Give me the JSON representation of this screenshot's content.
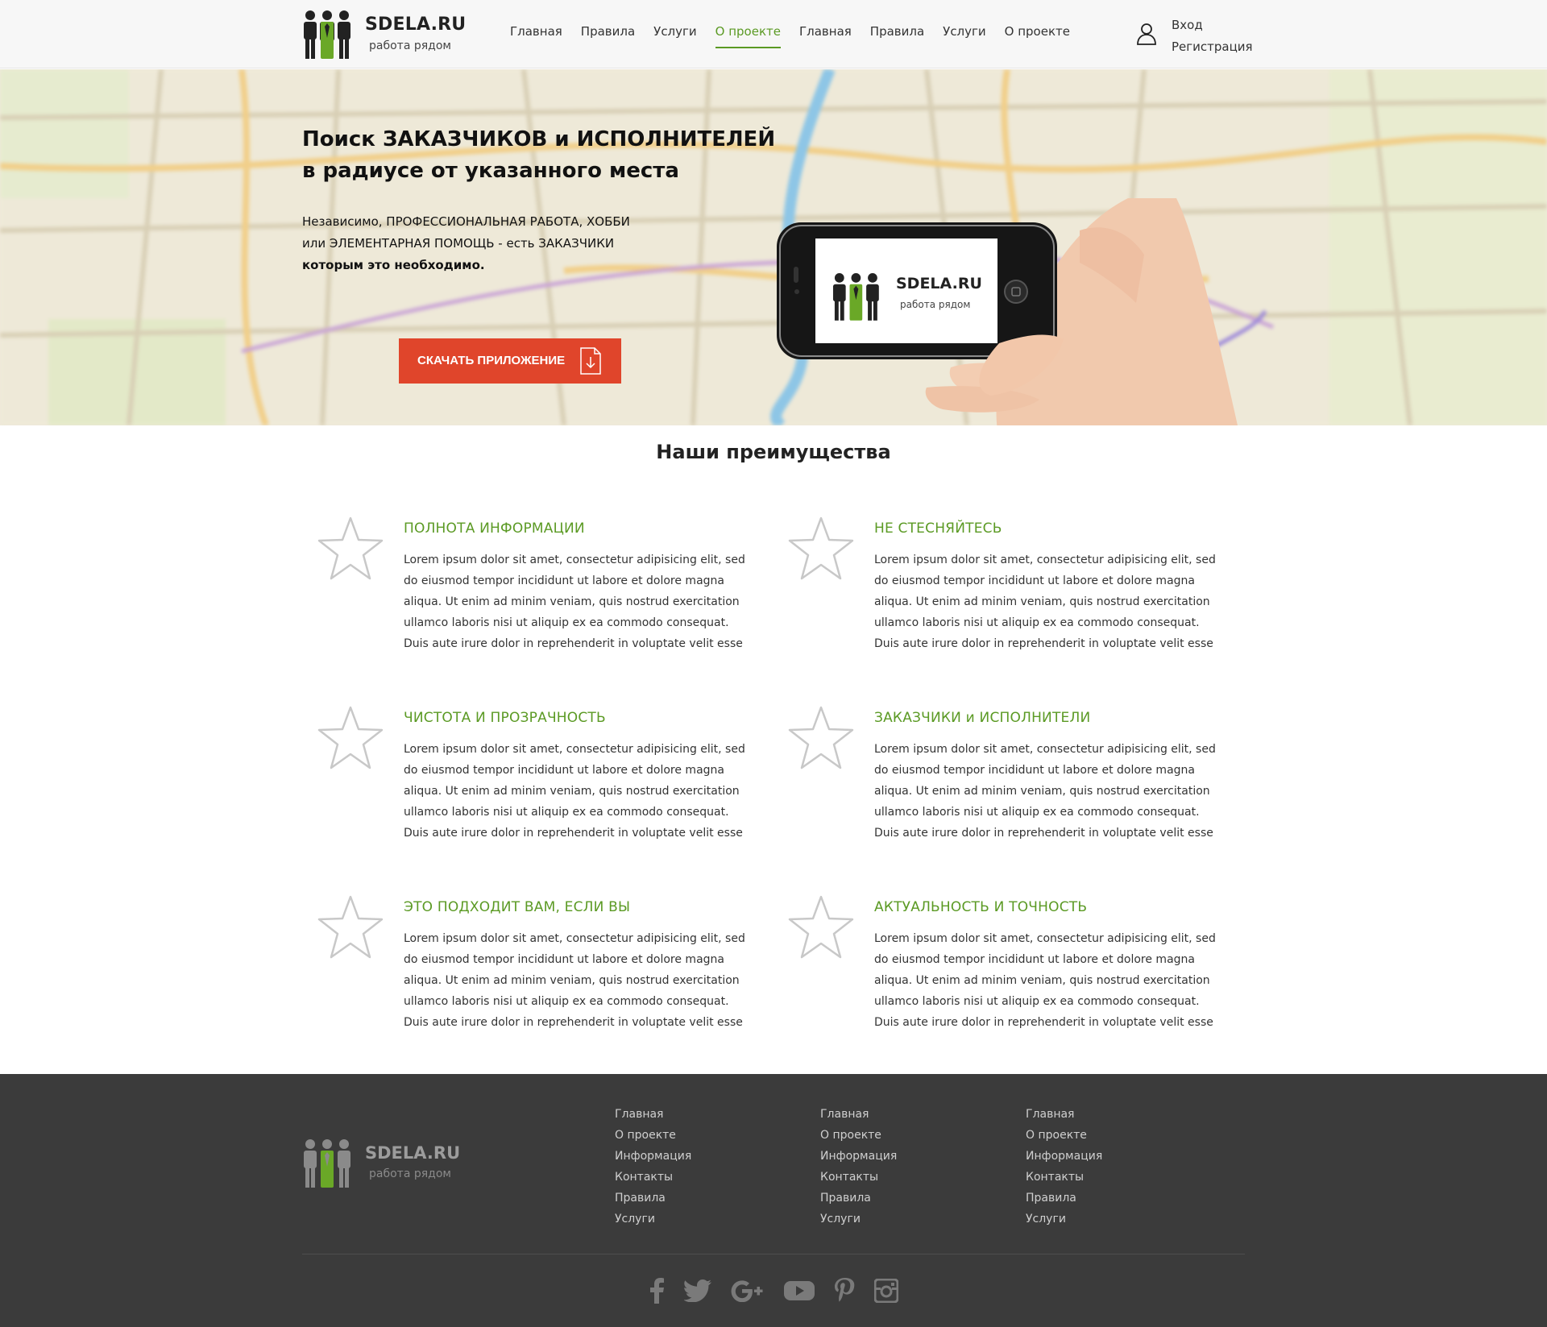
{
  "header": {
    "logo_name": "SDELA.RU",
    "logo_tagline": "работа рядом",
    "nav": [
      {
        "label": "Главная"
      },
      {
        "label": "Правила"
      },
      {
        "label": "Услуги"
      },
      {
        "label": "О проекте",
        "active": true
      },
      {
        "label": "Главная"
      },
      {
        "label": "Правила"
      },
      {
        "label": "Услуги"
      },
      {
        "label": "О проекте"
      }
    ],
    "login": "Вход",
    "register": "Регистрация"
  },
  "hero": {
    "title_line1": "Поиск ЗАКАЗЧИКОВ и ИСПОЛНИТЕЛЕЙ",
    "title_line2": "в радиусе от указанного места",
    "text_line1": "Независимо, ПРОФЕССИОНАЛЬНАЯ РАБОТА, ХОББИ",
    "text_line2": "или ЭЛЕМЕНТАРНАЯ ПОМОЩЬ  - есть ЗАКАЗЧИКИ",
    "text_line3": "которым это необходимо.",
    "download_button": "СКАЧАТЬ ПРИЛОЖЕНИЕ",
    "phone_logo_name": "SDELA.RU",
    "phone_logo_tagline": "работа рядом"
  },
  "advantages": {
    "title": "Наши преимущества",
    "items": [
      {
        "heading": "ПОЛНОТА ИНФОРМАЦИИ",
        "l1": "Lorem ipsum dolor sit amet, consectetur adipisicing elit, sed",
        "l2": "do eiusmod tempor incididunt ut labore et dolore magna",
        "l3": "aliqua. Ut enim ad minim veniam, quis nostrud exercitation",
        "l4": "ullamco laboris nisi ut aliquip ex ea commodo consequat.",
        "l5": "Duis aute irure dolor in reprehenderit in voluptate velit esse"
      },
      {
        "heading": "НЕ СТЕСНЯЙТЕСЬ",
        "l1": "Lorem ipsum dolor sit amet, consectetur adipisicing elit, sed",
        "l2": "do eiusmod tempor incididunt ut labore et dolore magna",
        "l3": "aliqua. Ut enim ad minim veniam, quis nostrud exercitation",
        "l4": "ullamco laboris nisi ut aliquip ex ea commodo consequat.",
        "l5": "Duis aute irure dolor in reprehenderit in voluptate velit esse"
      },
      {
        "heading": "ЧИСТОТА И ПРОЗРАЧНОСТЬ",
        "l1": "Lorem ipsum dolor sit amet, consectetur adipisicing elit, sed",
        "l2": "do eiusmod tempor incididunt ut labore et dolore magna",
        "l3": "aliqua. Ut enim ad minim veniam, quis nostrud exercitation",
        "l4": "ullamco laboris nisi ut aliquip ex ea commodo consequat.",
        "l5": "Duis aute irure dolor in reprehenderit in voluptate velit esse"
      },
      {
        "heading": "ЗАКАЗЧИКИ и ИСПОЛНИТЕЛИ",
        "l1": "Lorem ipsum dolor sit amet, consectetur adipisicing elit, sed",
        "l2": "do eiusmod tempor incididunt ut labore et dolore magna",
        "l3": "aliqua. Ut enim ad minim veniam, quis nostrud exercitation",
        "l4": "ullamco laboris nisi ut aliquip ex ea commodo consequat.",
        "l5": "Duis aute irure dolor in reprehenderit in voluptate velit esse"
      },
      {
        "heading": "ЭТО ПОДХОДИТ ВАМ, ЕСЛИ ВЫ",
        "l1": "Lorem ipsum dolor sit amet, consectetur adipisicing elit, sed",
        "l2": "do eiusmod tempor incididunt ut labore et dolore magna",
        "l3": "aliqua. Ut enim ad minim veniam, quis nostrud exercitation",
        "l4": "ullamco laboris nisi ut aliquip ex ea commodo consequat.",
        "l5": "Duis aute irure dolor in reprehenderit in voluptate velit esse"
      },
      {
        "heading": "АКТУАЛЬНОСТЬ И ТОЧНОСТЬ",
        "l1": "Lorem ipsum dolor sit amet, consectetur adipisicing elit, sed",
        "l2": "do eiusmod tempor incididunt ut labore et dolore magna",
        "l3": "aliqua. Ut enim ad minim veniam, quis nostrud exercitation",
        "l4": "ullamco laboris nisi ut aliquip ex ea commodo consequat.",
        "l5": "Duis aute irure dolor in reprehenderit in voluptate velit esse"
      }
    ]
  },
  "footer": {
    "logo_name": "SDELA.RU",
    "logo_tagline": "работа рядом",
    "columns": [
      {
        "links": [
          "Главная",
          "О проекте",
          "Информация",
          "Контакты",
          "Правила",
          "Услуги"
        ]
      },
      {
        "links": [
          "Главная",
          "О проекте",
          "Информация",
          "Контакты",
          "Правила",
          "Услуги"
        ]
      },
      {
        "links": [
          "Главная",
          "О проекте",
          "Информация",
          "Контакты",
          "Правила",
          "Услуги"
        ]
      }
    ],
    "social_icons": [
      "facebook-icon",
      "twitter-icon",
      "google-plus-icon",
      "youtube-icon",
      "pinterest-icon",
      "instagram-icon"
    ]
  },
  "colors": {
    "brand_green": "#5b9a24",
    "button_red": "#e0452b",
    "footer_bg": "#3b3b3b"
  }
}
